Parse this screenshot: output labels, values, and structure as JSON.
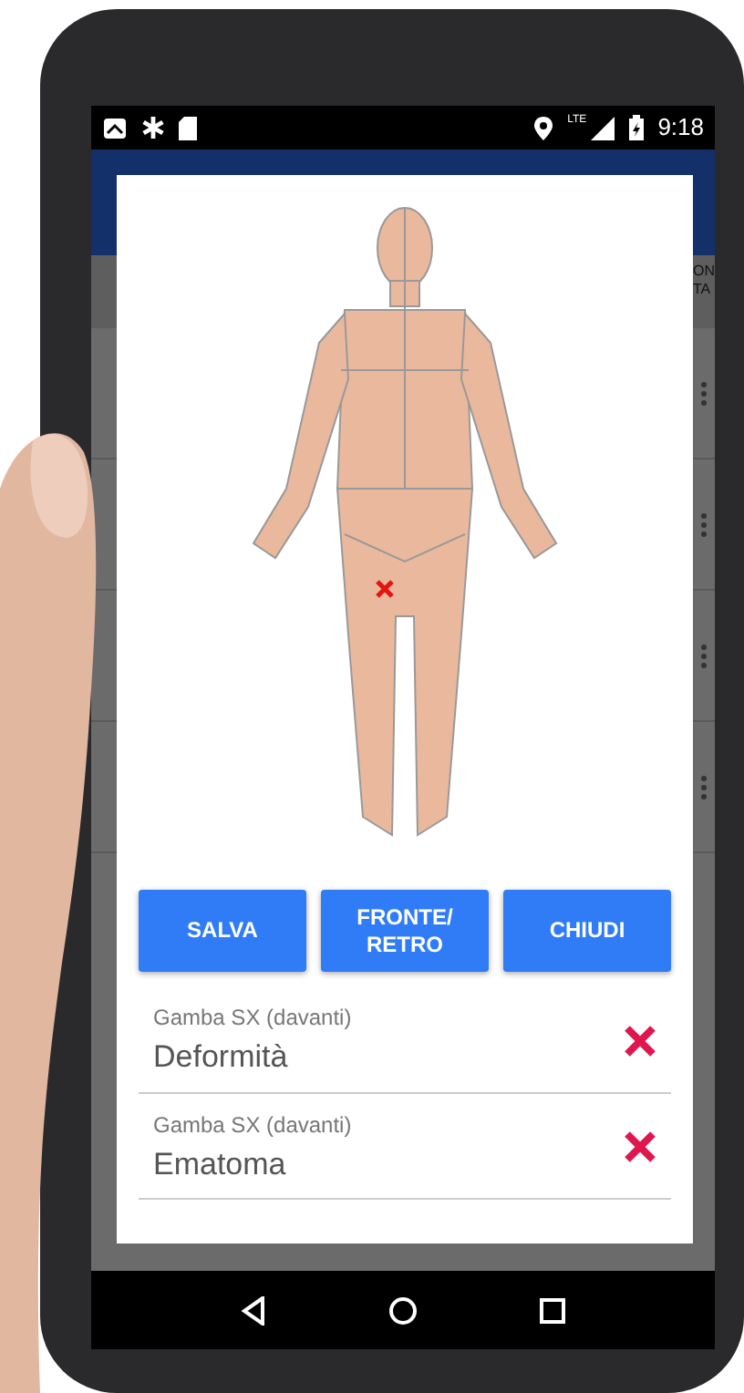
{
  "status_bar": {
    "network": "LTE",
    "time": "9:18"
  },
  "background_screen": {
    "header_fragment": [
      "ON",
      "TA"
    ]
  },
  "dialog": {
    "buttons": [
      "SALVA",
      "FRONTE/\nRETRO",
      "CHIUDI"
    ],
    "entries": [
      {
        "region": "Gamba SX (davanti)",
        "finding": "Deformità"
      },
      {
        "region": "Gamba SX (davanti)",
        "finding": "Ematoma"
      }
    ]
  }
}
